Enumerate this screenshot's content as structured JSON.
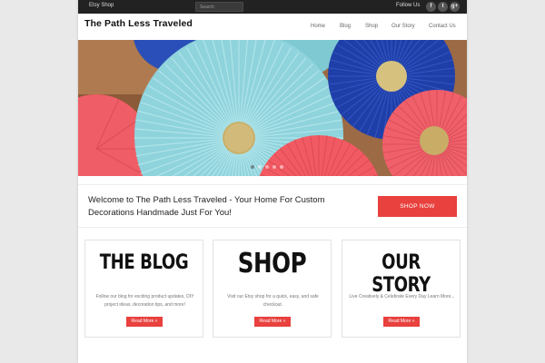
{
  "topbar": {
    "etsy_shop": "Etsy Shop",
    "search_placeholder": "Search",
    "follow_us": "Follow Us",
    "social": [
      {
        "glyph": "f",
        "icon": "facebook-icon"
      },
      {
        "glyph": "t",
        "icon": "twitter-icon"
      },
      {
        "glyph": "g+",
        "icon": "google-plus-icon"
      }
    ]
  },
  "header": {
    "site_title": "The Path Less Traveled",
    "nav": [
      "Home",
      "Blog",
      "Shop",
      "Our Story",
      "Contact Us"
    ]
  },
  "hero": {
    "slide_count": 5,
    "active_slide": 1
  },
  "welcome": {
    "text": "Welcome to The Path Less Traveled - Your Home For Custom Decorations Handmade Just For You!",
    "button": "SHOP NOW"
  },
  "cards": [
    {
      "title": "THE BLOG",
      "description": "Follow our blog for exciting product updates, DIY project ideas, decoration tips, and more!",
      "button": "Read More »"
    },
    {
      "title": "SHOP",
      "description": "Visit our Etsy shop for a quick, easy, and safe checkout.",
      "button": "Read More »"
    },
    {
      "title": "OUR STORY",
      "description": "Live Creatively & Celebrate Every Day Learn More...",
      "button": "Read More »"
    }
  ],
  "colors": {
    "accent": "#e8413e",
    "topbar": "#222222",
    "rosette_light_blue": "#8fd3dc",
    "rosette_blue": "#1f3fa8",
    "rosette_coral": "#f25a63",
    "gold": "#c9b06a"
  }
}
